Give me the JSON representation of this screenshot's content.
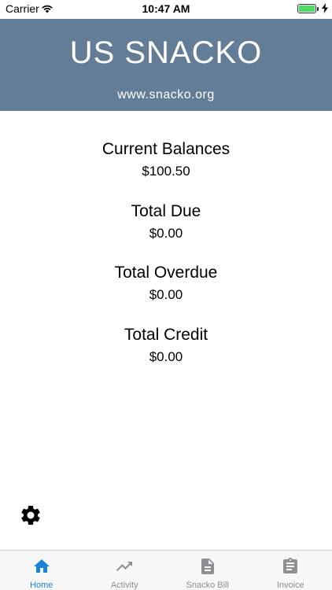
{
  "status_bar": {
    "carrier": "Carrier",
    "time": "10:47 AM",
    "battery_level": 1.0
  },
  "header": {
    "title": "US SNACKO",
    "url": "www.snacko.org",
    "background": "#647d96"
  },
  "balances": [
    {
      "label": "Current Balances",
      "value": "$100.50"
    },
    {
      "label": "Total Due",
      "value": "$0.00"
    },
    {
      "label": "Total Overdue",
      "value": "$0.00"
    },
    {
      "label": "Total Credit",
      "value": "$0.00"
    }
  ],
  "settings": {
    "icon": "gear-icon"
  },
  "tabbar": {
    "active_color": "#1a82d9",
    "inactive_color": "#8e8e93",
    "tabs": [
      {
        "label": "Home",
        "icon": "home-icon",
        "active": true
      },
      {
        "label": "Activity",
        "icon": "trending-up-icon",
        "active": false
      },
      {
        "label": "Snacko Bill",
        "icon": "document-icon",
        "active": false
      },
      {
        "label": "Invoice",
        "icon": "clipboard-icon",
        "active": false
      }
    ]
  }
}
